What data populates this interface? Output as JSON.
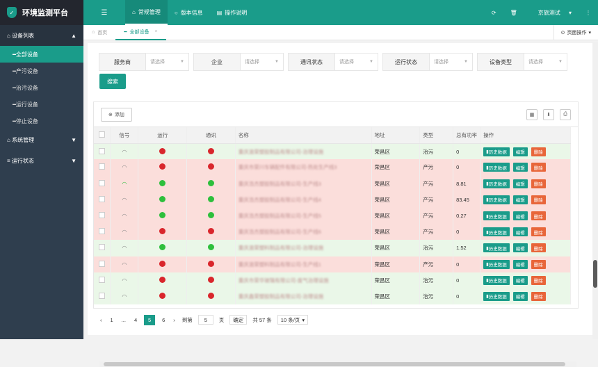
{
  "app": {
    "title": "环境监测平台",
    "logo_icon": "shield-icon"
  },
  "topnav": {
    "menu_icon": "menu-icon",
    "items": [
      {
        "label": "常规管理",
        "icon": "home-icon",
        "active": true
      },
      {
        "label": "版本信息",
        "icon": "refresh-icon",
        "active": false
      },
      {
        "label": "操作说明",
        "icon": "book-icon",
        "active": false
      }
    ],
    "user": "京旅测试",
    "more": "⋮"
  },
  "sidebar": {
    "groups": [
      {
        "label": "设备列表",
        "open": true,
        "subitems": [
          {
            "label": "全部设备",
            "active": true
          },
          {
            "label": "产污设备"
          },
          {
            "label": "治污设备"
          },
          {
            "label": "运行设备"
          },
          {
            "label": "停止设备"
          }
        ]
      },
      {
        "label": "系统管理",
        "open": false
      },
      {
        "label": "运行状态",
        "open": false
      }
    ]
  },
  "tabs": {
    "home": "首页",
    "current": "全部设备",
    "page_ops": "页面操作"
  },
  "filters": [
    {
      "label": "服务商",
      "placeholder": "请选择"
    },
    {
      "label": "企业",
      "placeholder": "请选择"
    },
    {
      "label": "通讯状态",
      "placeholder": "请选择"
    },
    {
      "label": "运行状态",
      "placeholder": "请选择"
    },
    {
      "label": "设备类型",
      "placeholder": "请选择"
    }
  ],
  "search_label": "搜索",
  "toolbar": {
    "add_label": "添加"
  },
  "table": {
    "headers": [
      "信号",
      "运行",
      "通讯",
      "名称",
      "地址",
      "类型",
      "总有功率",
      "操作"
    ],
    "ops": {
      "history": "历史数据",
      "edit": "编辑",
      "delete": "删除"
    },
    "rows": [
      {
        "status": "green",
        "signal": false,
        "run": "red",
        "comm": "red",
        "name": "重庆渝荣塑胶制品有限公司-治理设施",
        "addr": "荣昌区",
        "type": "治污",
        "power": "0"
      },
      {
        "status": "red",
        "signal": false,
        "run": "red",
        "comm": "red",
        "name": "重庆市荣川车辆配件有限公司-热处生产线3",
        "addr": "荣昌区",
        "type": "产污",
        "power": "0"
      },
      {
        "status": "red",
        "signal": true,
        "run": "green",
        "comm": "green",
        "name": "重庆浩杰塑胶制品有限公司-生产线3",
        "addr": "荣昌区",
        "type": "产污",
        "power": "8.81"
      },
      {
        "status": "red",
        "signal": false,
        "run": "green",
        "comm": "green",
        "name": "重庆浩杰塑胶制品有限公司-生产线4",
        "addr": "荣昌区",
        "type": "产污",
        "power": "83.45"
      },
      {
        "status": "red",
        "signal": false,
        "run": "green",
        "comm": "green",
        "name": "重庆浩杰塑胶制品有限公司-生产线5",
        "addr": "荣昌区",
        "type": "产污",
        "power": "0.27"
      },
      {
        "status": "red",
        "signal": false,
        "run": "red",
        "comm": "red",
        "name": "重庆浩杰塑胶制品有限公司-生产线6",
        "addr": "荣昌区",
        "type": "产污",
        "power": "0"
      },
      {
        "status": "green",
        "signal": false,
        "run": "green",
        "comm": "green",
        "name": "重庆渝荣塑料制品有限公司-治理设施",
        "addr": "荣昌区",
        "type": "治污",
        "power": "1.52"
      },
      {
        "status": "red",
        "signal": false,
        "run": "red",
        "comm": "red",
        "name": "重庆渝荣塑料制品有限公司-生产线1",
        "addr": "荣昌区",
        "type": "产污",
        "power": "0"
      },
      {
        "status": "green",
        "signal": false,
        "run": "red",
        "comm": "red",
        "name": "重庆市荣华玻璃有限公司-废气治理设施",
        "addr": "荣昌区",
        "type": "治污",
        "power": "0"
      },
      {
        "status": "green",
        "signal": false,
        "run": "red",
        "comm": "red",
        "name": "重庆鑫荣塑胶制品有限公司-治理设施",
        "addr": "荣昌区",
        "type": "治污",
        "power": "0"
      }
    ]
  },
  "pager": {
    "prev": "‹",
    "first": "1",
    "ellipsis": "...",
    "p4": "4",
    "current": "5",
    "p6": "6",
    "next": "›",
    "goto_label": "到第",
    "goto_value": "5",
    "page_unit": "页",
    "confirm": "确定",
    "total": "共 57 条",
    "page_size": "10 条/页"
  }
}
